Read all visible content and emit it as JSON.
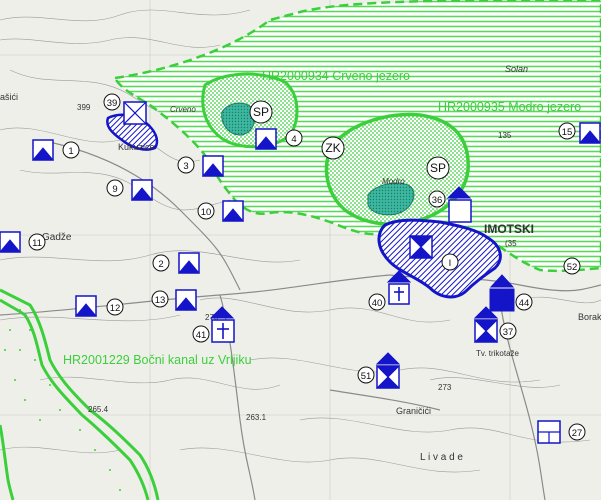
{
  "zones": {
    "crveno": "HR2000934 Crveno jezero",
    "modro": "HR2000935 Modro jezero",
    "kanal": "HR2001229 Bočni kanal uz Vrljiku"
  },
  "zone_codes": {
    "sp1": "SP",
    "sp2": "SP",
    "zk": "ZK"
  },
  "places": {
    "imotski": "IMOTSKI",
    "gadze": "Gadže",
    "kukunce": "Kukuzice",
    "granicici": "Graničići",
    "livade": "L i v a d e",
    "solan": "Solan",
    "crveno": "Crveno",
    "bora": "Borak",
    "trikotaze": "Tv. trikotaže",
    "modro": "Modro",
    "asici": "ašići",
    "n399": "399",
    "n2654": "265.4",
    "n263": "263.1",
    "n273": "273",
    "n270": "270",
    "n35": "(35",
    "n135": "135"
  },
  "markers": [
    {
      "id": "1",
      "label": "1"
    },
    {
      "id": "2",
      "label": "2"
    },
    {
      "id": "3",
      "label": "3"
    },
    {
      "id": "4",
      "label": "4"
    },
    {
      "id": "9",
      "label": "9"
    },
    {
      "id": "10",
      "label": "10"
    },
    {
      "id": "11",
      "label": "11"
    },
    {
      "id": "12",
      "label": "12"
    },
    {
      "id": "13",
      "label": "13"
    },
    {
      "id": "15",
      "label": "15"
    },
    {
      "id": "27",
      "label": "27"
    },
    {
      "id": "36",
      "label": "36"
    },
    {
      "id": "37",
      "label": "37"
    },
    {
      "id": "39",
      "label": "39"
    },
    {
      "id": "40",
      "label": "40"
    },
    {
      "id": "41",
      "label": "41"
    },
    {
      "id": "44",
      "label": "44"
    },
    {
      "id": "51",
      "label": "51"
    },
    {
      "id": "52",
      "label": "52"
    },
    {
      "id": "I",
      "label": "I"
    }
  ],
  "colors": {
    "natura_green": "#3ccf3c",
    "lake_fill": "#2eb89a",
    "monument_blue": "#1414c8",
    "background": "#f2f2ee"
  },
  "icons": {
    "triangle": "triangle-in-square-icon",
    "hourglass": "hourglass-in-square-icon",
    "cross": "cross-in-square-icon",
    "empty": "empty-square-icon",
    "grid": "window-grid-icon"
  }
}
